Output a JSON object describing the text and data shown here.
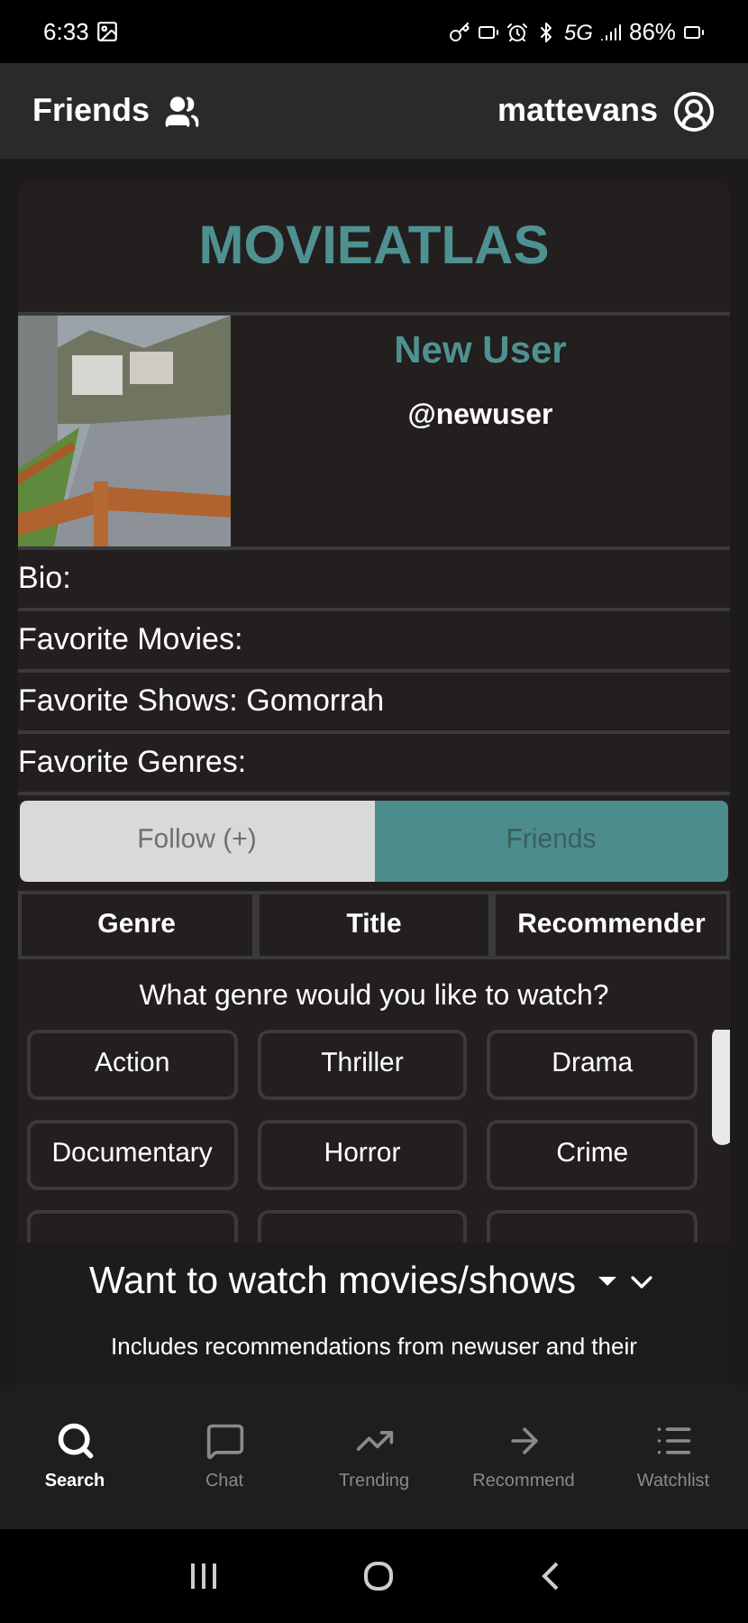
{
  "status_bar": {
    "time": "6:33",
    "network": "5G",
    "battery": "86%"
  },
  "header": {
    "left_title": "Friends",
    "username": "mattevans"
  },
  "card": {
    "app_title": "MOVIEATLAS",
    "profile": {
      "name": "New User",
      "handle": "@newuser"
    },
    "fields": [
      {
        "text": "Bio:"
      },
      {
        "text": "Favorite Movies:"
      },
      {
        "text": "Favorite Shows: Gomorrah"
      },
      {
        "text": "Favorite Genres:"
      }
    ],
    "actions": [
      {
        "label": "Follow (+)",
        "kind": "follow"
      },
      {
        "label": "Friends",
        "kind": "friends"
      }
    ],
    "tabs": [
      {
        "label": "Genre",
        "selected": false
      },
      {
        "label": "Title",
        "selected": false
      },
      {
        "label": "Recommender",
        "selected": false
      }
    ],
    "question": "What genre would you like to watch?",
    "genres": [
      {
        "label": "Action"
      },
      {
        "label": "Thriller"
      },
      {
        "label": "Drama"
      },
      {
        "label": "Documentary"
      },
      {
        "label": "Horror"
      },
      {
        "label": "Crime"
      }
    ]
  },
  "sheet": {
    "title": "Want to watch movies/shows",
    "note": "Includes recommendations from newuser and their"
  },
  "bottom_nav": [
    {
      "label": "Search",
      "selected": true
    },
    {
      "label": "Chat",
      "selected": false
    },
    {
      "label": "Trending",
      "selected": false
    },
    {
      "label": "Recommend",
      "selected": false
    },
    {
      "label": "Watchlist",
      "selected": false
    }
  ]
}
